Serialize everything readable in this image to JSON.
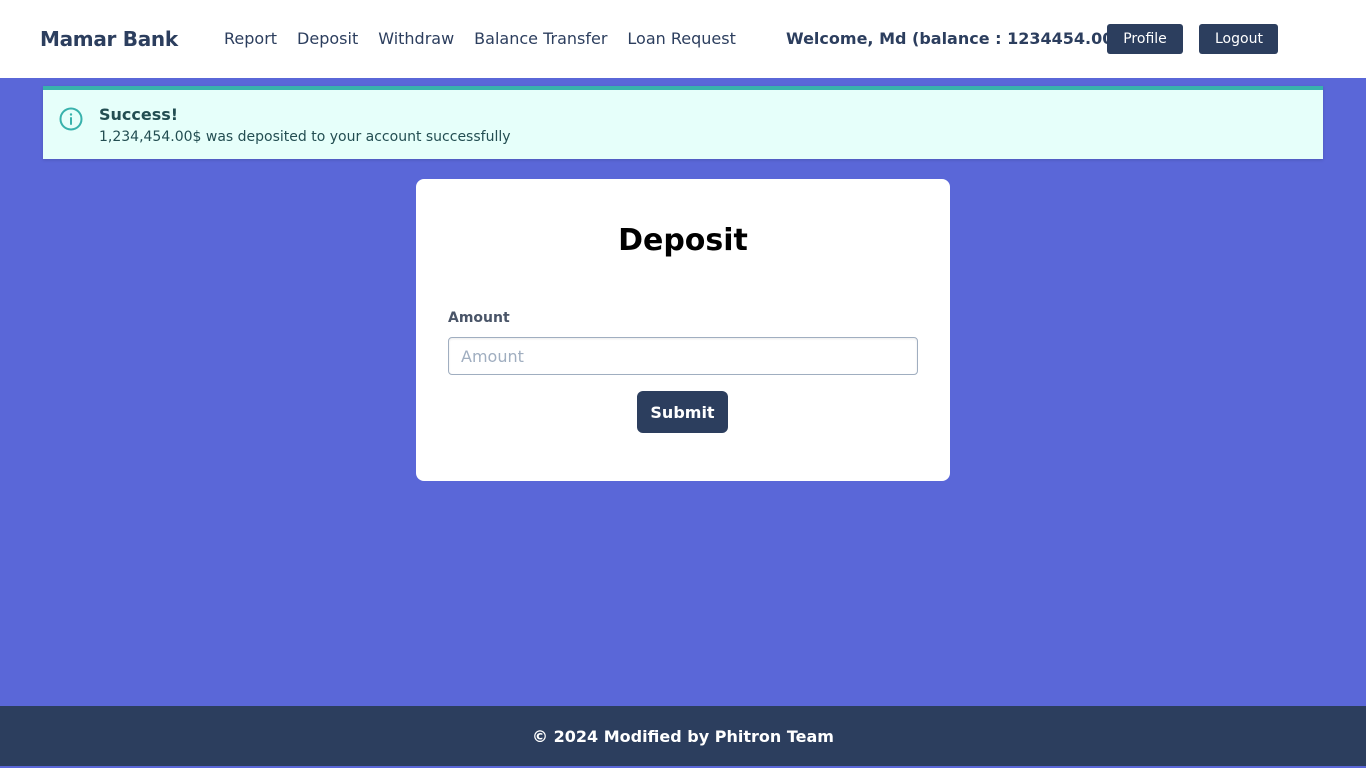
{
  "brand": "Mamar Bank",
  "nav": {
    "links": [
      "Report",
      "Deposit",
      "Withdraw",
      "Balance Transfer",
      "Loan Request"
    ],
    "welcome": "Welcome, Md (balance : 1234454.00)",
    "profile_label": "Profile",
    "logout_label": "Logout"
  },
  "alert": {
    "icon": "info-icon",
    "title": "Success!",
    "message": "1,234,454.00$ was deposited to your account successfully",
    "accent_color": "#38b2ac",
    "background_color": "#e6fffa"
  },
  "form": {
    "title": "Deposit",
    "amount_label": "Amount",
    "amount_placeholder": "Amount",
    "amount_value": "",
    "submit_label": "Submit"
  },
  "footer": {
    "text": "© 2024 Modified by Phitron Team"
  },
  "colors": {
    "page_background": "#5a67d8",
    "primary": "#2c3e5e"
  }
}
